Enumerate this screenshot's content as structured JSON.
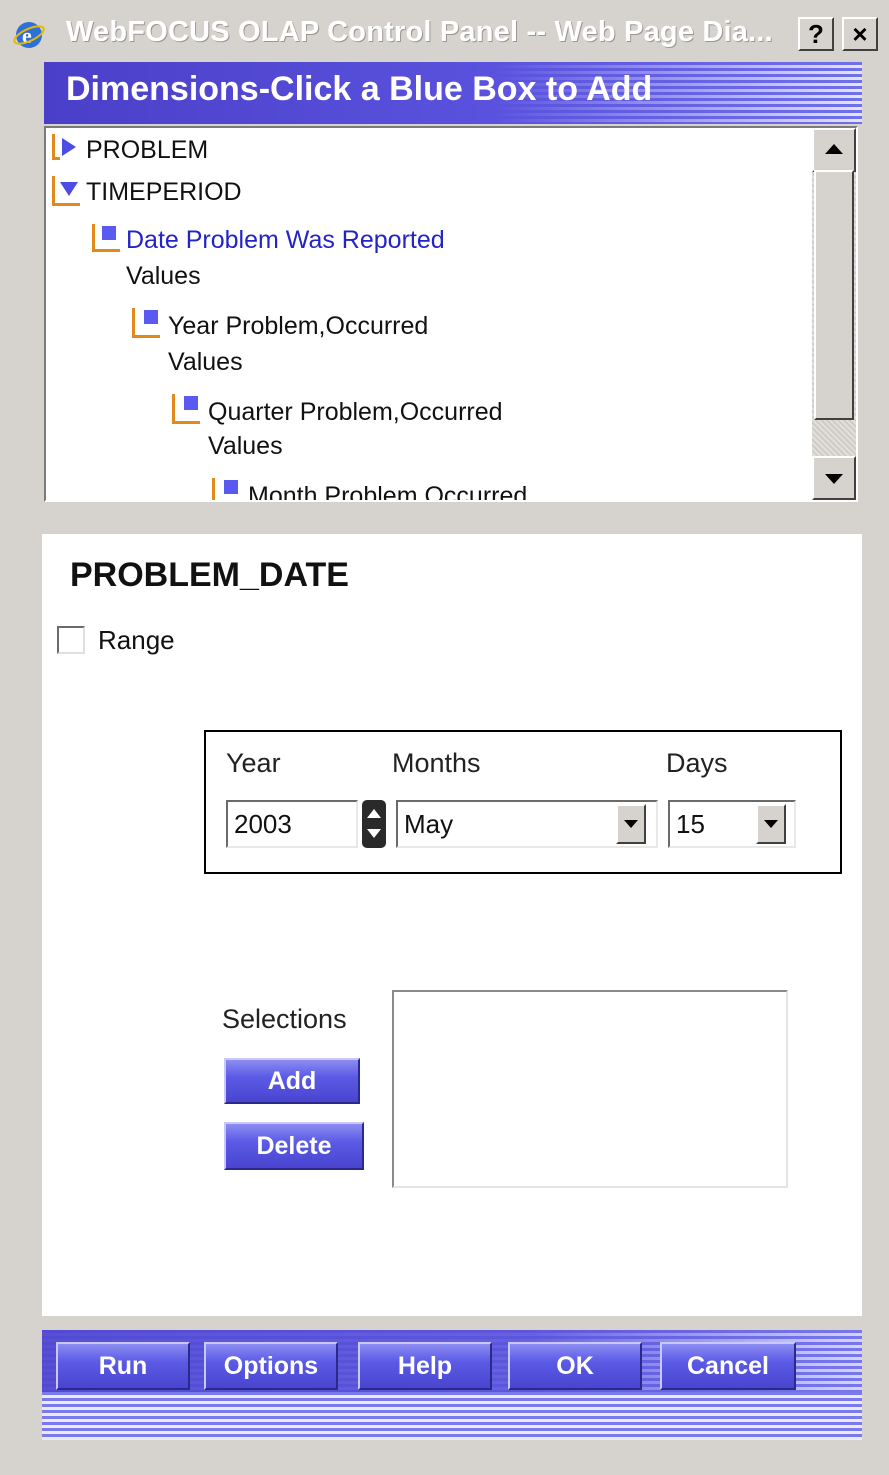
{
  "window": {
    "title": "WebFOCUS OLAP Control Panel -- Web Page Dia...",
    "help_button": "?",
    "close_button": "×"
  },
  "dimensions": {
    "header": "Dimensions-Click a Blue Box to Add",
    "tree": [
      {
        "label": "PROBLEM",
        "type": "collapsed"
      },
      {
        "label": "TIMEPERIOD",
        "type": "expanded"
      },
      {
        "label": "Date Problem Was Reported",
        "sub": "Values"
      },
      {
        "label": "Year Problem,Occurred",
        "sub": "Values"
      },
      {
        "label": "Quarter Problem,Occurred",
        "sub": "Values"
      },
      {
        "label": "Month Problem,Occurred"
      }
    ]
  },
  "panel": {
    "title": "PROBLEM_DATE",
    "range_label": "Range",
    "date": {
      "year_label": "Year",
      "months_label": "Months",
      "days_label": "Days",
      "year_value": "2003",
      "month_value": "May",
      "day_value": "15"
    },
    "selections_label": "Selections",
    "add_button": "Add",
    "delete_button": "Delete"
  },
  "footer": {
    "run": "Run",
    "options": "Options",
    "help": "Help",
    "ok": "OK",
    "cancel": "Cancel"
  },
  "colors": {
    "accent": "#5a52de",
    "tree_link": "#2323c8",
    "elbow": "#e08a1e",
    "box": "#5a5af0"
  }
}
